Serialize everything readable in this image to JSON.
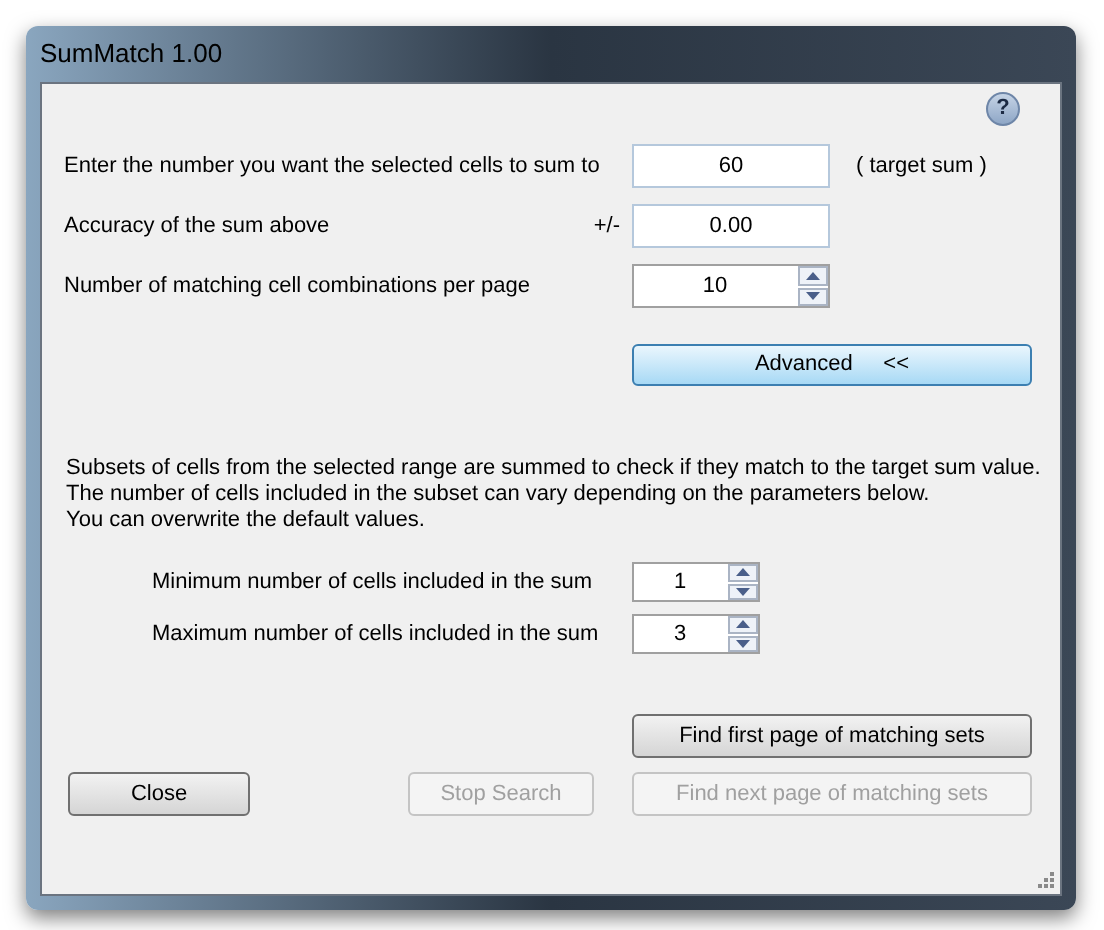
{
  "window": {
    "title": "SumMatch 1.00"
  },
  "help_button": {
    "label": "?"
  },
  "fields": [
    {
      "kind": "text",
      "label": "Enter the number you want the selected cells to sum to",
      "value": "60",
      "suffix": "( target sum )"
    },
    {
      "kind": "text",
      "label": "Accuracy of the sum above",
      "prefix": "+/-",
      "value": "0.00"
    },
    {
      "kind": "spinner",
      "label": "Number of matching cell combinations per page",
      "value": "10"
    }
  ],
  "advanced_button": {
    "label": "Advanced     <<"
  },
  "description": [
    "Subsets of cells from the selected range are summed to check if they match to the target sum value.",
    "The number of cells included in the subset can vary depending on the parameters below.",
    "You can overwrite the default values."
  ],
  "range_fields": [
    {
      "label": "Minimum number of cells included in the sum",
      "value": "1"
    },
    {
      "label": "Maximum number of cells included in the sum",
      "value": "3"
    }
  ],
  "find_first_button": {
    "label": "Find first page of matching sets",
    "disabled": false
  },
  "bottom_buttons": [
    {
      "label": "Close",
      "disabled": false
    },
    {
      "label": "Stop Search",
      "disabled": true
    },
    {
      "label": "Find next page of matching sets",
      "disabled": true
    }
  ]
}
